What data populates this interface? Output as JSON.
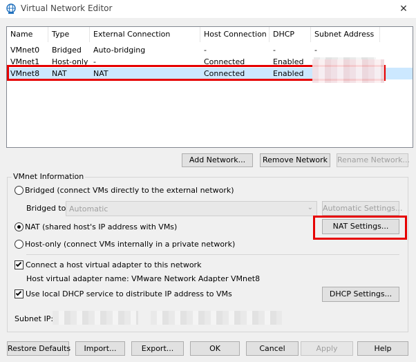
{
  "window": {
    "title": "Virtual Network Editor"
  },
  "network_list": {
    "columns": [
      "Name",
      "Type",
      "External Connection",
      "Host Connection",
      "DHCP",
      "Subnet Address"
    ],
    "rows": [
      {
        "name": "VMnet0",
        "type": "Bridged",
        "external": "Auto-bridging",
        "host": "-",
        "dhcp": "-",
        "subnet": "-"
      },
      {
        "name": "VMnet1",
        "type": "Host-only",
        "external": "-",
        "host": "Connected",
        "dhcp": "Enabled",
        "subnet": ""
      },
      {
        "name": "VMnet8",
        "type": "NAT",
        "external": "NAT",
        "host": "Connected",
        "dhcp": "Enabled",
        "subnet": ""
      }
    ],
    "selected_row": "VMnet8"
  },
  "list_buttons": {
    "add": "Add Network...",
    "remove": "Remove Network",
    "rename": "Rename Network..."
  },
  "vmnet_info": {
    "group_label": "VMnet Information",
    "bridged_label": "Bridged (connect VMs directly to the external network)",
    "bridged_to_label": "Bridged to:",
    "bridged_to_value": "Automatic",
    "auto_settings": "Automatic Settings...",
    "nat_label": "NAT (shared host's IP address with VMs)",
    "nat_settings": "NAT Settings...",
    "hostonly_label": "Host-only (connect VMs internally in a private network)",
    "selected_mode": "NAT",
    "connect_adapter_label": "Connect a host virtual adapter to this network",
    "connect_adapter_checked": true,
    "adapter_name_label": "Host virtual adapter name: VMware Network Adapter VMnet8",
    "dhcp_label": "Use local DHCP service to distribute IP address to VMs",
    "dhcp_checked": true,
    "dhcp_settings": "DHCP Settings...",
    "subnet_ip_label": "Subnet IP:"
  },
  "footer": {
    "restore": "Restore Defaults",
    "import": "Import...",
    "export": "Export...",
    "ok": "OK",
    "cancel": "Cancel",
    "apply": "Apply",
    "help": "Help"
  },
  "icons": {
    "title": "globe-network-icon",
    "close": "close-icon"
  },
  "colors": {
    "highlight": "#e60000",
    "selection": "#cce8ff",
    "accent": "#0078d7"
  }
}
